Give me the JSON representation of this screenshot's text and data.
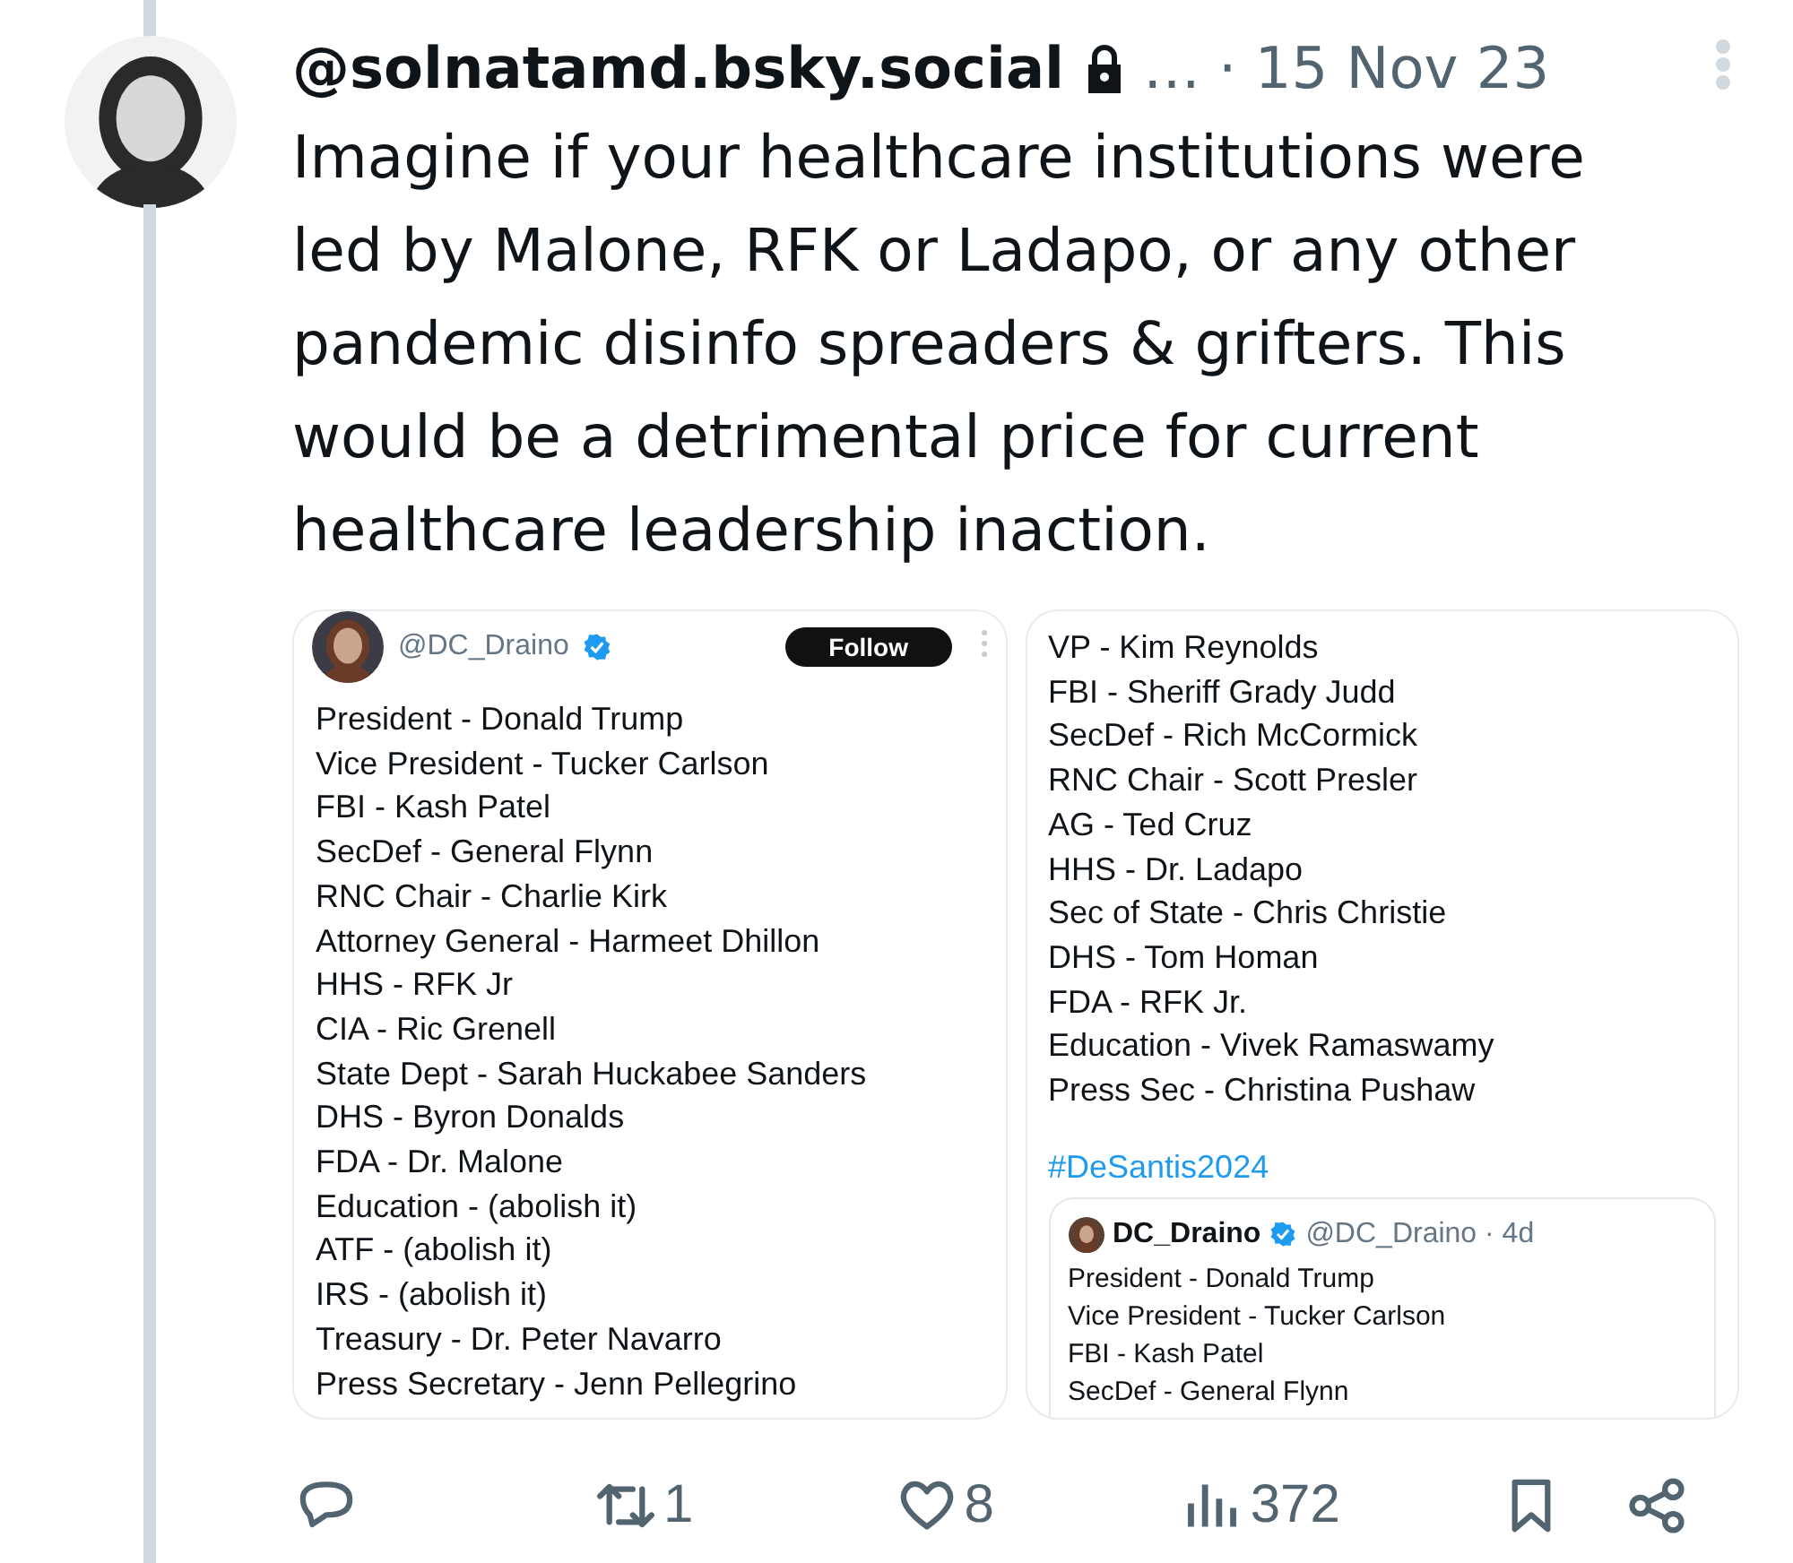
{
  "post": {
    "handle": "@solnatamd.bsky.social",
    "locked": true,
    "more": "…",
    "date": "· 15 Nov 23",
    "text": "Imagine if your healthcare institutions were led by Malone, RFK or Ladapo, or any other pandemic disinfo spreaders & grifters. This would be a detrimental price for current healthcare leadership inaction."
  },
  "images": [
    {
      "kind": "tweet",
      "handle": "@DC_Draino",
      "verified": true,
      "follow": "Follow",
      "lines": [
        "President - Donald Trump",
        "Vice President - Tucker Carlson",
        "FBI - Kash Patel",
        "SecDef - General Flynn",
        "RNC Chair - Charlie Kirk",
        "Attorney General - Harmeet Dhillon",
        "HHS - RFK Jr",
        "CIA - Ric Grenell",
        "State Dept - Sarah Huckabee Sanders",
        "DHS - Byron Donalds",
        "FDA - Dr. Malone",
        "Education - (abolish it)",
        "ATF - (abolish it)",
        "IRS - (abolish it)",
        "Treasury - Dr. Peter Navarro",
        "Press Secretary - Jenn Pellegrino"
      ]
    },
    {
      "kind": "quote",
      "lines": [
        "VP - Kim Reynolds",
        "FBI - Sheriff Grady Judd",
        "SecDef - Rich McCormick",
        "RNC Chair - Scott Presler",
        "AG - Ted Cruz",
        "HHS - Dr. Ladapo",
        "Sec of State - Chris Christie",
        "DHS - Tom Homan",
        "FDA - RFK Jr.",
        "Education - Vivek Ramaswamy",
        "Press Sec - Christina Pushaw"
      ],
      "hashtag": "#DeSantis2024",
      "quote": {
        "name": "DC_Draino",
        "verified": true,
        "handle_time": "@DC_Draino · 4d",
        "lines": [
          "President - Donald Trump",
          "Vice President - Tucker Carlson",
          "FBI - Kash Patel",
          "SecDef - General Flynn"
        ]
      }
    }
  ],
  "actions": [
    {
      "kind": "reply"
    },
    {
      "kind": "repost",
      "count": "1"
    },
    {
      "kind": "like",
      "count": "8"
    },
    {
      "kind": "views",
      "count": "372"
    },
    {
      "kind": "bookmark"
    },
    {
      "kind": "share"
    }
  ]
}
